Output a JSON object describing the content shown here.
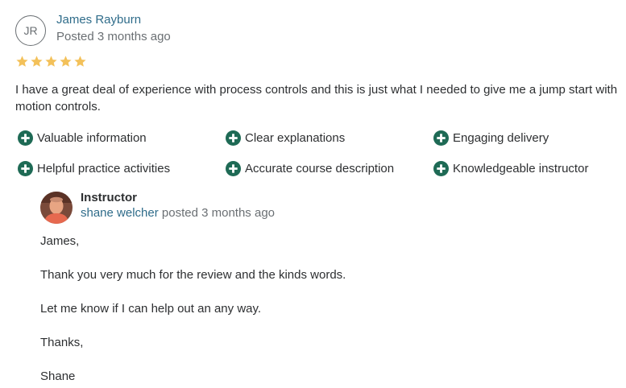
{
  "review": {
    "avatar_initials": "JR",
    "reviewer_name": "James Rayburn",
    "posted": "Posted 3 months ago",
    "rating": 5,
    "star_color": "#f3c15a",
    "text": "I have a great deal of experience with process controls and this is just what I needed to give me a jump start with motion controls.",
    "tags": [
      "Valuable information",
      "Clear explanations",
      "Engaging delivery",
      "Helpful practice activities",
      "Accurate course description",
      "Knowledgeable instructor"
    ],
    "tag_icon": "plus-circle-icon",
    "tag_icon_color": "#1e6a55"
  },
  "reply": {
    "role": "Instructor",
    "name": "shane welcher",
    "posted": "posted 3 months ago",
    "paragraphs": [
      "James,",
      "Thank you very much for the review and the kinds words.",
      "Let me know if I can help out an any way.",
      "Thanks,",
      "Shane"
    ]
  }
}
